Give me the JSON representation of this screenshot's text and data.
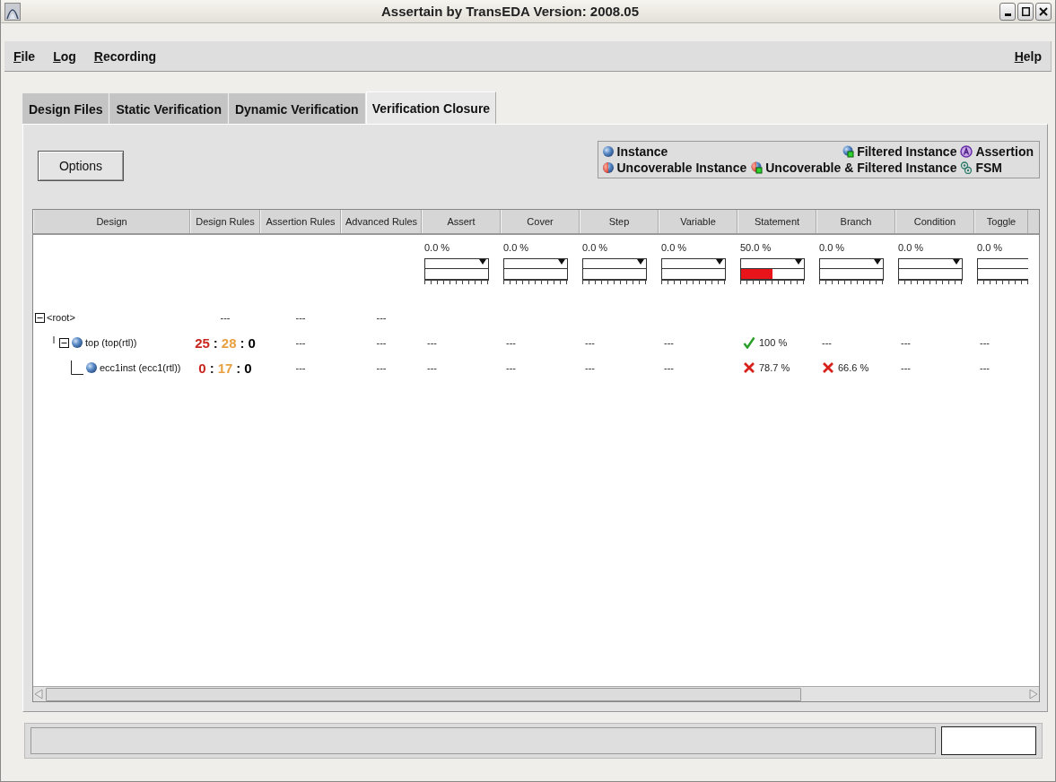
{
  "window": {
    "title": "Assertain by TransEDA Version: 2008.05"
  },
  "menu": {
    "left": [
      "File",
      "Log",
      "Recording"
    ],
    "right": [
      "Help"
    ]
  },
  "tabs": [
    {
      "label": "Design Files",
      "selected": false
    },
    {
      "label": "Static Verification",
      "selected": false
    },
    {
      "label": "Dynamic Verification",
      "selected": false
    },
    {
      "label": "Verification Closure",
      "selected": true
    }
  ],
  "options_button": "Options",
  "legend": [
    {
      "kind": "instance",
      "label": "Instance"
    },
    {
      "kind": "filtered",
      "label": "Filtered Instance"
    },
    {
      "kind": "assertion",
      "label": "Assertion"
    },
    {
      "kind": "uncoverable",
      "label": "Uncoverable Instance"
    },
    {
      "kind": "uncoverable-filtered",
      "label": "Uncoverable & Filtered Instance"
    },
    {
      "kind": "fsm",
      "label": "FSM"
    }
  ],
  "table": {
    "columns": [
      "Design",
      "Design Rules",
      "Assertion Rules",
      "Advanced Rules",
      "Assert",
      "Cover",
      "Step",
      "Variable",
      "Statement",
      "Branch",
      "Condition",
      "Toggle"
    ],
    "summary": [
      {
        "percent": "0.0 %"
      },
      {
        "percent": "0.0 %"
      },
      {
        "percent": "0.0 %"
      },
      {
        "percent": "0.0 %"
      },
      {
        "percent": "50.0 %",
        "level": 0.5
      },
      {
        "percent": "0.0 %"
      },
      {
        "percent": "0.0 %"
      },
      {
        "percent": "0.0 %"
      }
    ],
    "tree": [
      {
        "label": "<root>",
        "expanded": true,
        "cells": [
          {
            "kind": "text",
            "text": "---"
          },
          {
            "kind": "text",
            "text": "---"
          },
          {
            "kind": "text",
            "text": "---"
          }
        ],
        "children": [
          {
            "kind": "instance",
            "label": "top (top(rtl))",
            "expanded": true,
            "cells": [
              {
                "kind": "counts",
                "separator": ":",
                "parts": [
                  {
                    "text": "25",
                    "color": "#c8261e"
                  },
                  {
                    "text": "28",
                    "color": "#e8a040"
                  },
                  {
                    "text": "0",
                    "color": "#000000"
                  }
                ]
              },
              {
                "kind": "text",
                "text": "---"
              },
              {
                "kind": "text",
                "text": "---"
              },
              {
                "kind": "text",
                "text": "---"
              },
              {
                "kind": "text",
                "text": "---"
              },
              {
                "kind": "text",
                "text": "---"
              },
              {
                "kind": "text",
                "text": "---"
              },
              {
                "kind": "pass",
                "text": "100 %"
              },
              {
                "kind": "text",
                "text": "---"
              },
              {
                "kind": "text",
                "text": "---"
              },
              {
                "kind": "text",
                "text": "---"
              }
            ],
            "children": [
              {
                "kind": "instance",
                "label": "ecc1inst (ecc1(rtl))",
                "cells": [
                  {
                    "kind": "counts",
                    "separator": ":",
                    "parts": [
                      {
                        "text": "0",
                        "color": "#c8261e"
                      },
                      {
                        "text": "17",
                        "color": "#e8a040"
                      },
                      {
                        "text": "0",
                        "color": "#000000"
                      }
                    ]
                  },
                  {
                    "kind": "text",
                    "text": "---"
                  },
                  {
                    "kind": "text",
                    "text": "---"
                  },
                  {
                    "kind": "text",
                    "text": "---"
                  },
                  {
                    "kind": "text",
                    "text": "---"
                  },
                  {
                    "kind": "text",
                    "text": "---"
                  },
                  {
                    "kind": "text",
                    "text": "---"
                  },
                  {
                    "kind": "fail",
                    "text": "78.7 %"
                  },
                  {
                    "kind": "fail",
                    "text": "66.6 %"
                  },
                  {
                    "kind": "text",
                    "text": "---"
                  },
                  {
                    "kind": "text",
                    "text": "---"
                  }
                ]
              }
            ]
          }
        ]
      }
    ]
  }
}
